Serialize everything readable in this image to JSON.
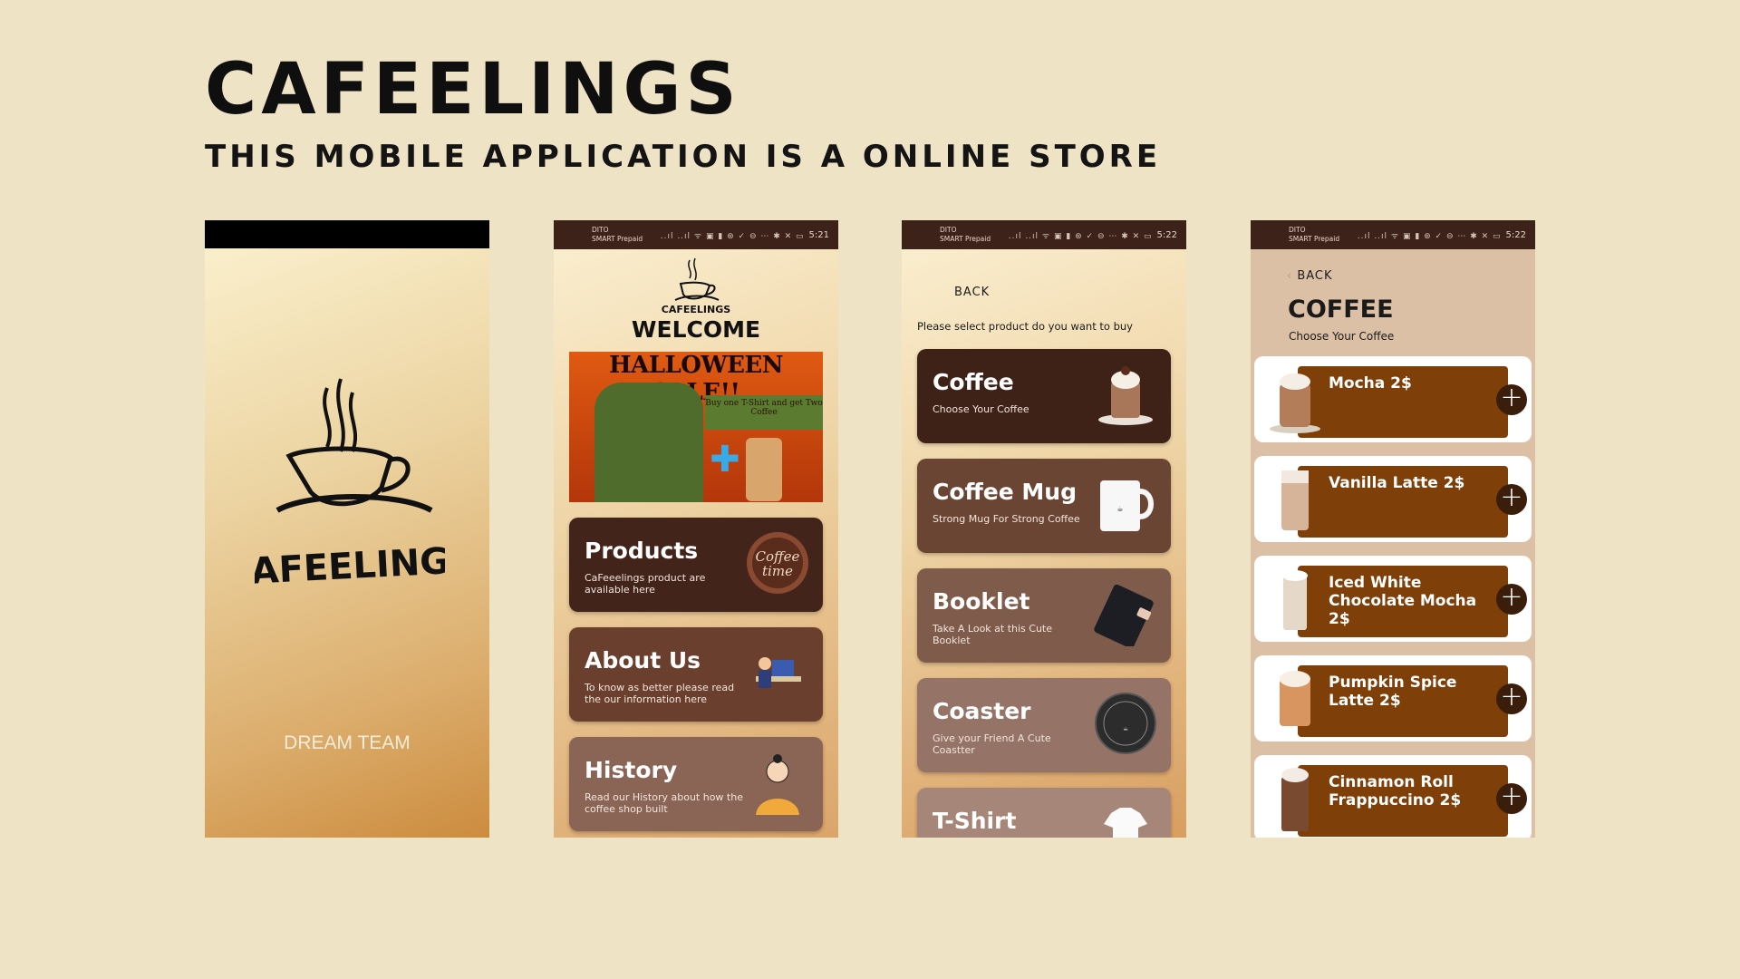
{
  "title": "CAFEELINGS",
  "subtitle": "THIS MOBILE APPLICATION IS A ONLINE STORE",
  "statusbar": {
    "carrier": "DITO",
    "plan": "SMART Prepaid",
    "icons": "..ıl ..ıl ᯤ ▣ ▮ ⊛ ✓ ⊖ ⋯ ✱ ✕ ▭",
    "time_p2": "5:21",
    "time_p3": "5:22",
    "time_p4": "5:22"
  },
  "splash": {
    "logo_text": "CAFEELINGS",
    "footer": "DREAM TEAM"
  },
  "home": {
    "logo_text": "CAFEELINGS",
    "welcome": "WELCOME",
    "banner_title": "HALLOWEEN SALE!!",
    "banner_promo": "Buy one T-Shirt and get Two Coffee",
    "cards": [
      {
        "title": "Products",
        "sub": "CaFeeelings product are available here",
        "color": "#43241a"
      },
      {
        "title": "About Us",
        "sub": "To know as better please read the our information here",
        "color": "#6b3f2d"
      },
      {
        "title": "History",
        "sub": "Read our History about how the coffee shop built",
        "color": "#8a6455"
      }
    ],
    "art_text": "Coffee time"
  },
  "products": {
    "back": "BACK",
    "prompt": "Please select product do you want to buy",
    "items": [
      {
        "title": "Coffee",
        "sub": "Choose Your Coffee",
        "color": "#3e2117"
      },
      {
        "title": "Coffee Mug",
        "sub": "Strong Mug For Strong Coffee",
        "color": "#6b4534"
      },
      {
        "title": "Booklet",
        "sub": "Take A Look at this Cute Booklet",
        "color": "#7f5b4b"
      },
      {
        "title": "Coaster",
        "sub": "Give your Friend A Cute Coastter",
        "color": "#957366"
      },
      {
        "title": "T-Shirt",
        "sub": "",
        "color": "#a58679"
      }
    ]
  },
  "coffee": {
    "back": "BACK",
    "heading": "COFFEE",
    "sub": "Choose Your Coffee",
    "items": [
      {
        "name": "Mocha 2$"
      },
      {
        "name": "Vanilla Latte 2$"
      },
      {
        "name": "Iced White Chocolate Mocha 2$"
      },
      {
        "name": "Pumpkin Spice Latte 2$"
      },
      {
        "name": "Cinnamon Roll Frappuccino 2$"
      }
    ],
    "add_symbol": "+"
  }
}
